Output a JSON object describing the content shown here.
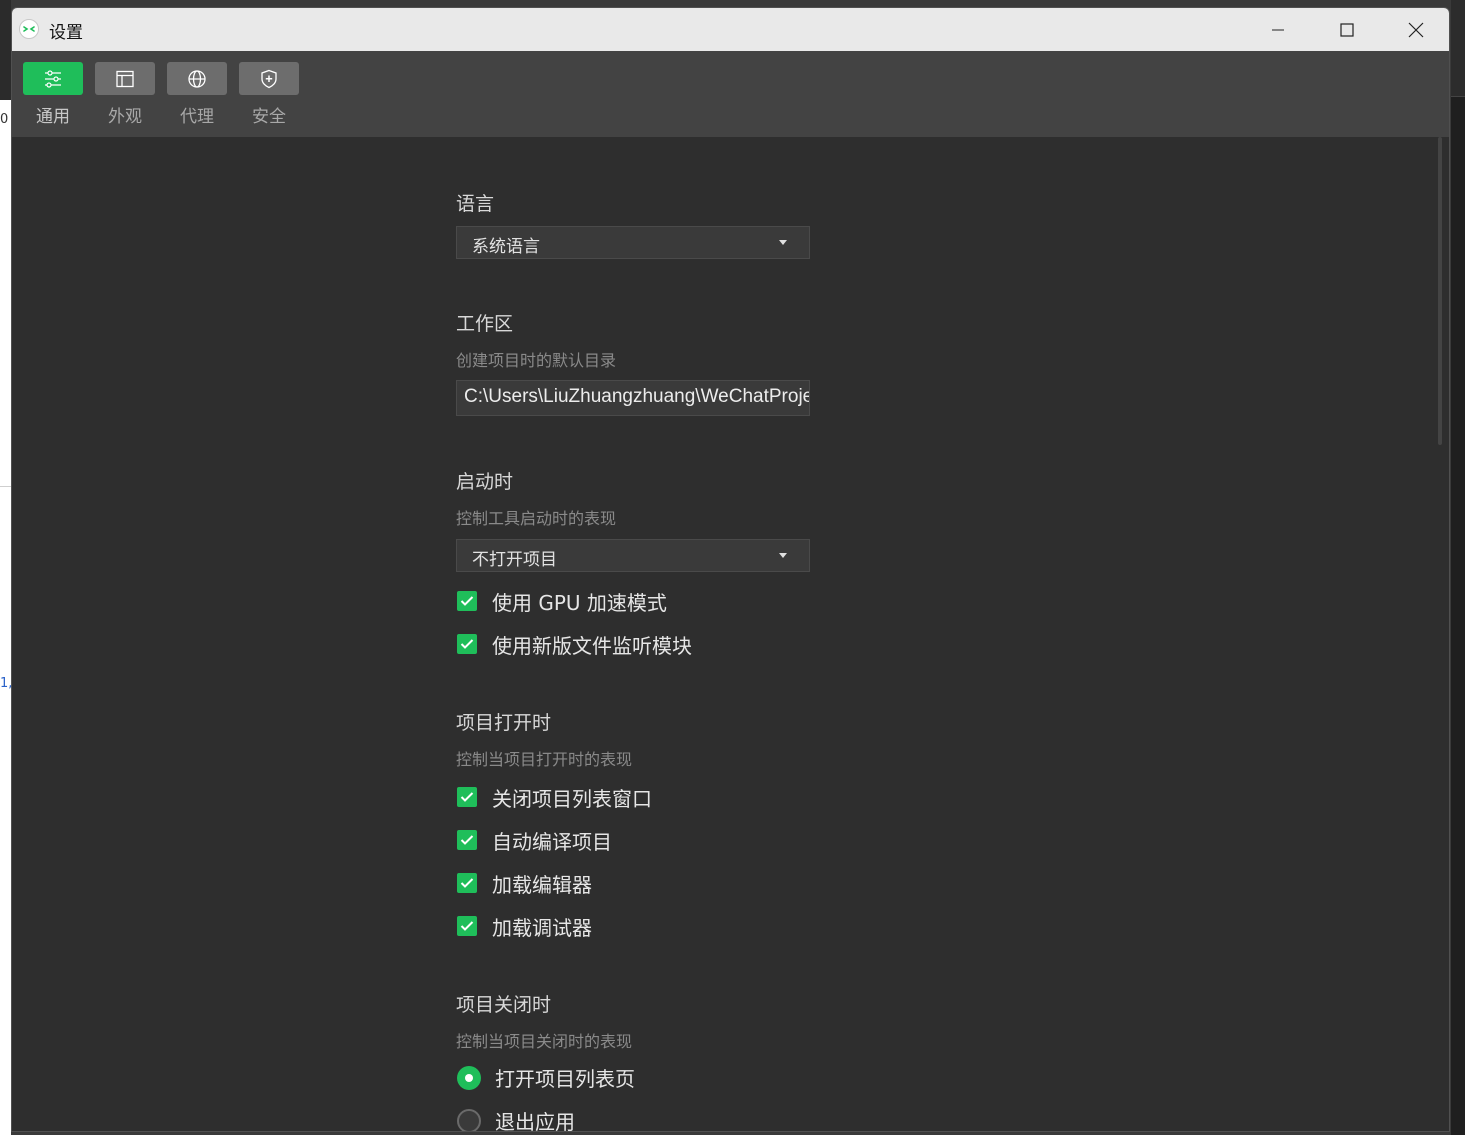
{
  "window": {
    "title": "设置"
  },
  "background_fragments": {
    "left_top": "0",
    "left_mid": "1,"
  },
  "toolbar": {
    "tabs": [
      {
        "label": "通用",
        "icon": "sliders-icon",
        "active": true
      },
      {
        "label": "外观",
        "icon": "window-icon",
        "active": false
      },
      {
        "label": "代理",
        "icon": "globe-icon",
        "active": false
      },
      {
        "label": "安全",
        "icon": "shield-icon",
        "active": false
      }
    ]
  },
  "language": {
    "title": "语言",
    "value": "系统语言"
  },
  "workspace": {
    "title": "工作区",
    "desc": "创建项目时的默认目录",
    "path": "C:\\Users\\LiuZhuangzhuang\\WeChatProjects"
  },
  "startup": {
    "title": "启动时",
    "desc": "控制工具启动时的表现",
    "value": "不打开项目",
    "options": [
      {
        "label": "使用 GPU 加速模式",
        "checked": true
      },
      {
        "label": "使用新版文件监听模块",
        "checked": true
      }
    ]
  },
  "project_open": {
    "title": "项目打开时",
    "desc": "控制当项目打开时的表现",
    "options": [
      {
        "label": "关闭项目列表窗口",
        "checked": true
      },
      {
        "label": "自动编译项目",
        "checked": true
      },
      {
        "label": "加载编辑器",
        "checked": true
      },
      {
        "label": "加载调试器",
        "checked": true
      }
    ]
  },
  "project_close": {
    "title": "项目关闭时",
    "desc": "控制当项目关闭时的表现",
    "options": [
      {
        "label": "打开项目列表页",
        "selected": true
      },
      {
        "label": "退出应用",
        "selected": false
      }
    ]
  },
  "colors": {
    "accent": "#1fbe5a",
    "background": "#2e2e2e",
    "toolbar": "#434343"
  }
}
